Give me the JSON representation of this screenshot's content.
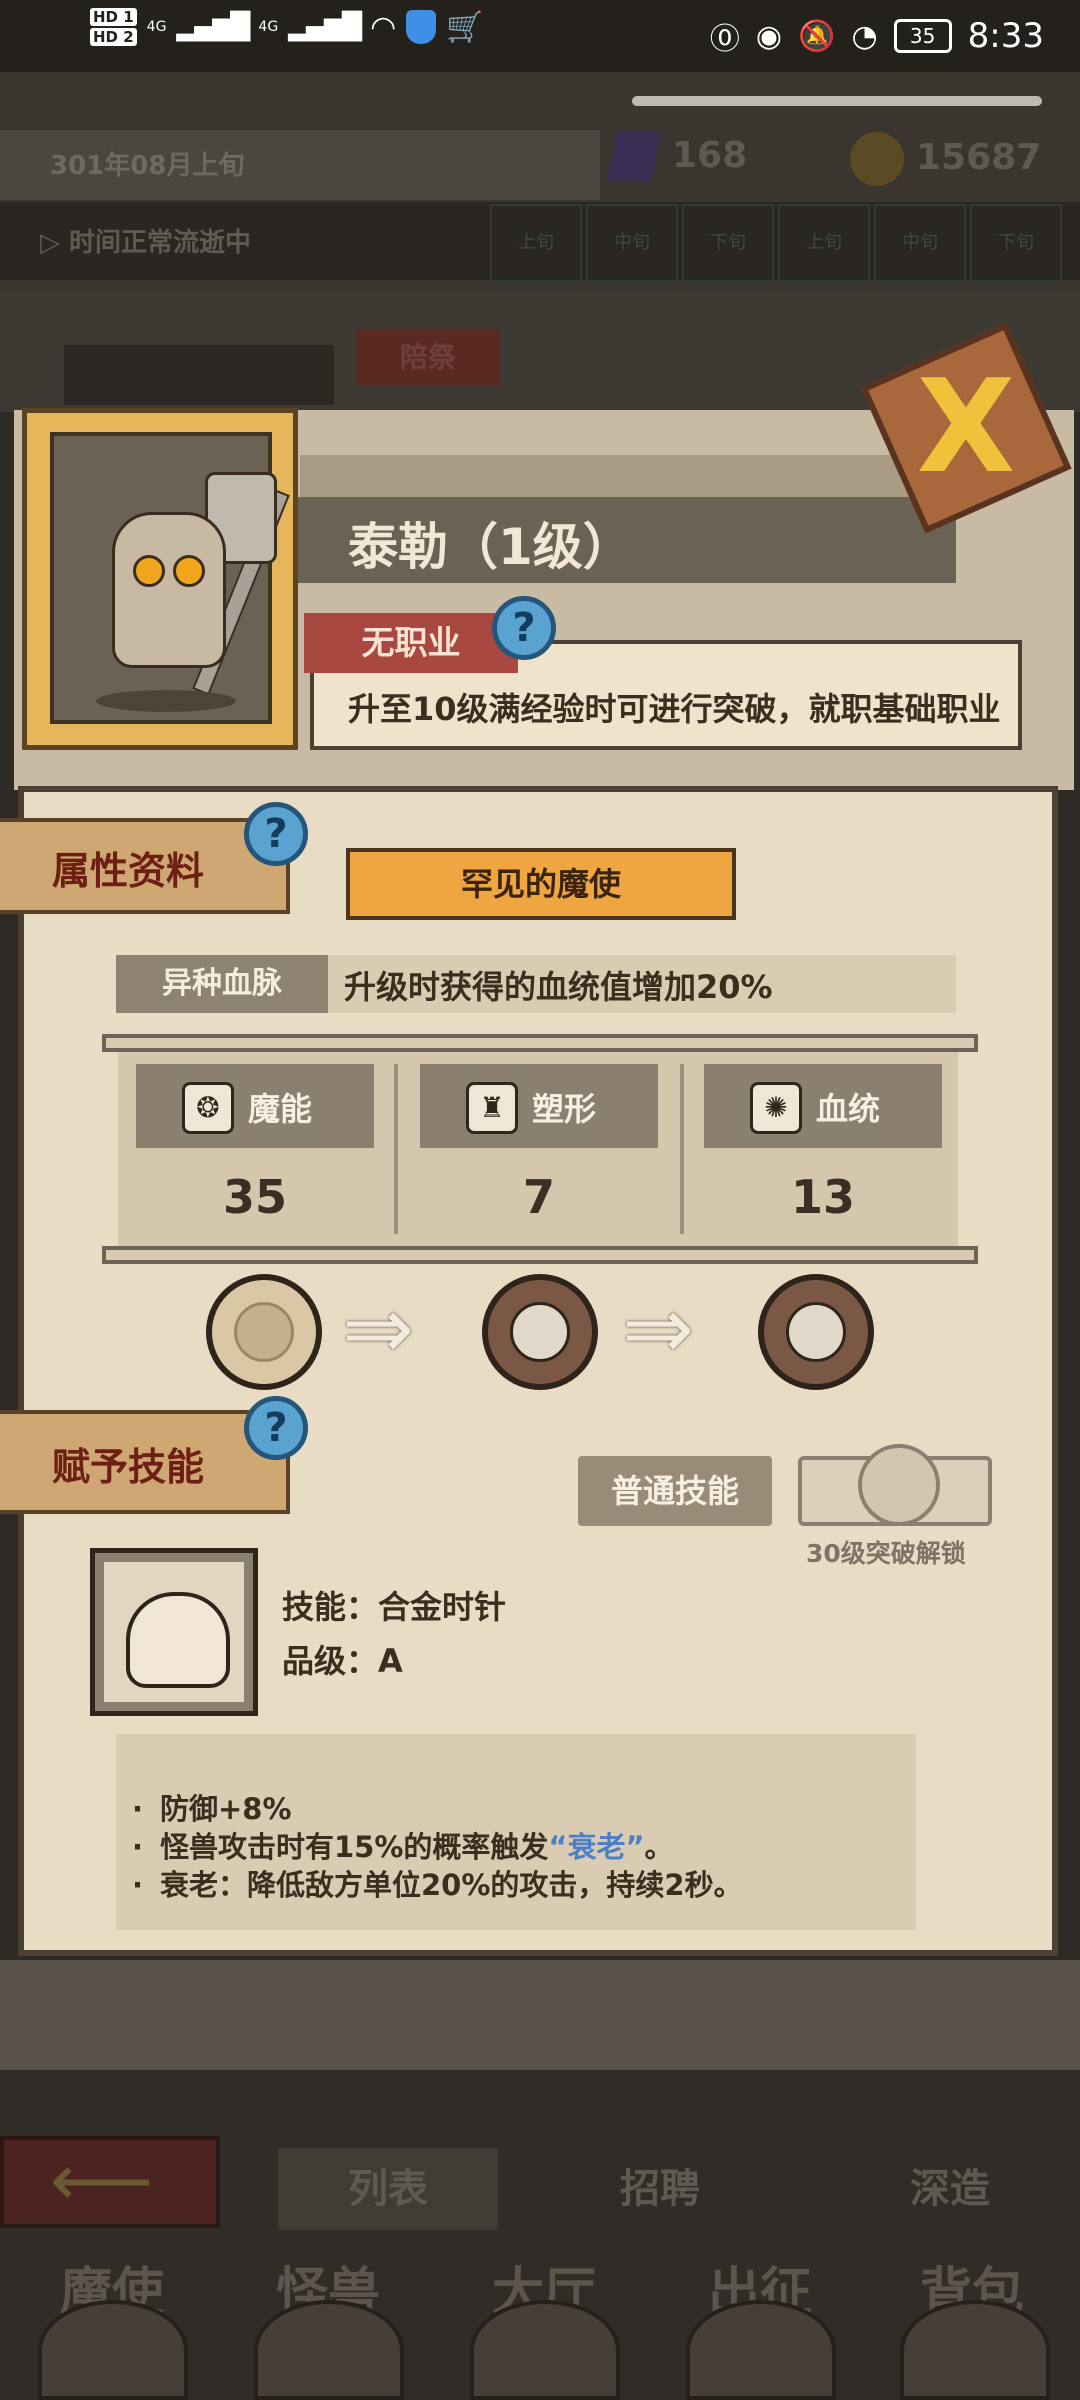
{
  "status_bar": {
    "sim1": "HD 1",
    "sim2": "HD 2",
    "network": "4G",
    "battery": "35",
    "time": "8:33"
  },
  "header": {
    "date": "301年08月上旬",
    "gems": "168",
    "coins": "15687",
    "time_status": "时间正常流逝中",
    "slots": [
      "上旬",
      "中旬",
      "下旬",
      "上旬",
      "中旬",
      "下旬"
    ],
    "top_tab": "陪祭"
  },
  "hero": {
    "name": "泰勒（1级）",
    "job": "无职业",
    "job_hint": "升至10级满经验时可进行突破，就职基础职业"
  },
  "attributes": {
    "title": "属性资料",
    "rarity": "罕见的魔使",
    "bloodline_tag": "异种血脉",
    "bloodline_desc": "升级时获得的血统值增加20%",
    "stats": [
      {
        "name": "魔能",
        "value": "35"
      },
      {
        "name": "塑形",
        "value": "7"
      },
      {
        "name": "血统",
        "value": "13"
      }
    ]
  },
  "skills": {
    "title": "赋予技能",
    "normal_button": "普通技能",
    "locked_slot_text": "30级突破解锁",
    "skill_name": "技能：合金时针",
    "skill_grade": "品级：A",
    "desc": {
      "line1": "防御+8%",
      "line2_pre": "怪兽攻击时有15%的概率触发",
      "line2_hl": "“衰老”",
      "line2_post": "。",
      "line3": "衰老：降低敌方单位20%的攻击，持续2秒。"
    }
  },
  "bottom": {
    "subtabs": [
      "列表",
      "招聘",
      "深造"
    ],
    "nav": [
      "魔使",
      "怪兽",
      "大厅",
      "出征",
      "背包"
    ]
  },
  "icons": {
    "help": "?",
    "close": "X",
    "back": "⟵",
    "arrow": "⇒"
  }
}
